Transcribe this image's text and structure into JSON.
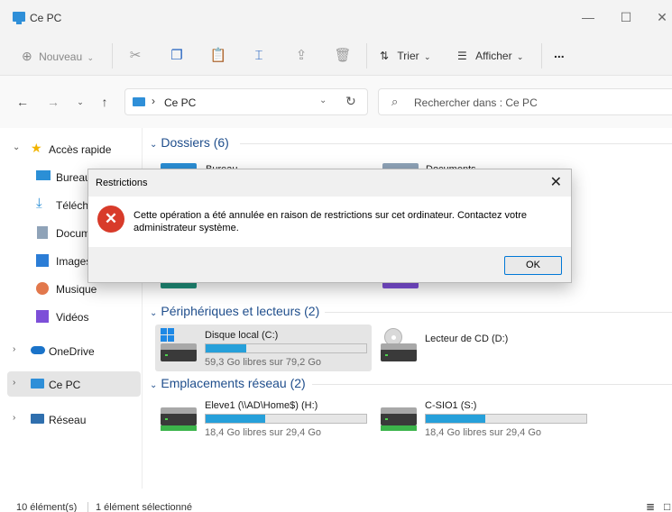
{
  "window": {
    "title": "Ce PC"
  },
  "toolbar": {
    "new_label": "Nouveau",
    "sort_label": "Trier",
    "view_label": "Afficher",
    "more_label": "..."
  },
  "address": {
    "breadcrumb": "Ce PC",
    "search_placeholder": "Rechercher dans : Ce PC"
  },
  "sidebar": {
    "quick_access": "Accès rapide",
    "items": [
      {
        "label": "Bureau",
        "icon": "desktop-folder-icon"
      },
      {
        "label": "Téléchargements",
        "icon": "downloads-folder-icon"
      },
      {
        "label": "Documents",
        "icon": "documents-folder-icon"
      },
      {
        "label": "Images",
        "icon": "pictures-folder-icon"
      },
      {
        "label": "Musique",
        "icon": "music-folder-icon"
      },
      {
        "label": "Vidéos",
        "icon": "videos-folder-icon"
      }
    ],
    "onedrive": "OneDrive",
    "this_pc": "Ce PC",
    "network": "Réseau"
  },
  "content": {
    "folders_header": "Dossiers (6)",
    "folders_visible": [
      "Bureau",
      "Documents"
    ],
    "devices_header": "Périphériques et lecteurs (2)",
    "drives": [
      {
        "name": "Disque local (C:)",
        "free": "59,3 Go libres sur 79,2 Go",
        "used_fraction": 0.25
      },
      {
        "name": "Lecteur de CD (D:)"
      }
    ],
    "network_header": "Emplacements réseau (2)",
    "network_drives": [
      {
        "name": "Eleve1 (\\\\AD\\Home$) (H:)",
        "free": "18,4 Go libres sur 29,4 Go",
        "used_fraction": 0.37
      },
      {
        "name": "C-SIO1 (S:)",
        "free": "18,4 Go libres sur 29,4 Go",
        "used_fraction": 0.37
      }
    ]
  },
  "statusbar": {
    "count": "10 élément(s)",
    "selection": "1 élément sélectionné"
  },
  "dialog": {
    "title": "Restrictions",
    "message": "Cette opération a été annulée en raison de restrictions sur cet ordinateur. Contactez votre administrateur système.",
    "ok_label": "OK"
  },
  "colors": {
    "accent": "#26a0da",
    "error": "#d83b2a",
    "header_text": "#1f4e8c"
  }
}
